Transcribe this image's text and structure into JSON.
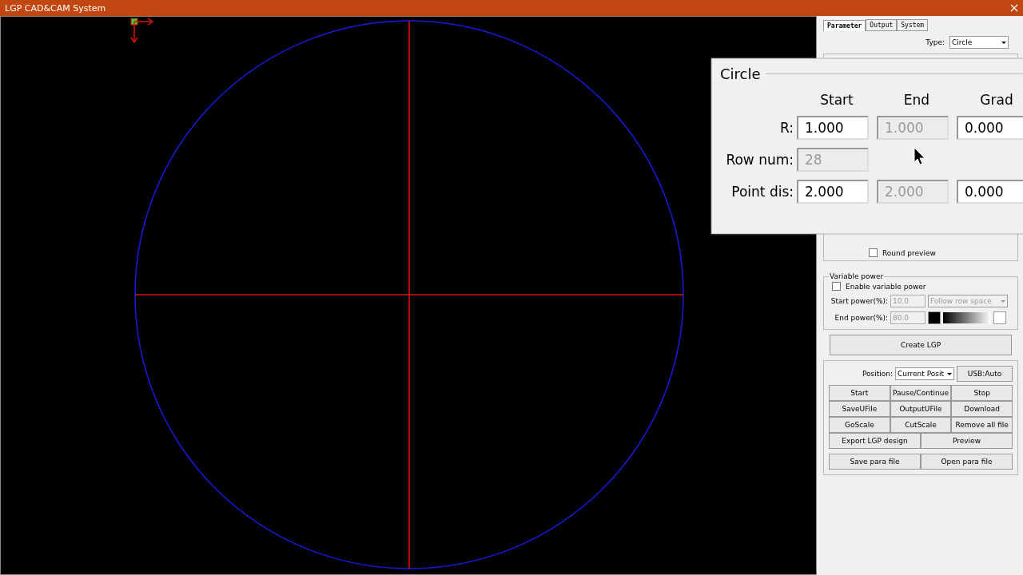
{
  "window": {
    "title": "LGP CAD&CAM System"
  },
  "tabs": [
    {
      "label": "Parameter",
      "selected": true
    },
    {
      "label": "Output",
      "selected": false
    },
    {
      "label": "System",
      "selected": false
    }
  ],
  "type": {
    "label": "Type:",
    "value": "Circle"
  },
  "round_preview": {
    "label": "Round preview",
    "checked": false
  },
  "variable_power": {
    "title": "Variable power",
    "enable": {
      "label": "Enable variable power",
      "checked": false
    },
    "start_power": {
      "label": "Start power(%):",
      "value": "10.0",
      "disabled": true
    },
    "mode": {
      "value": "Follow row space",
      "disabled": true
    },
    "end_power": {
      "label": "End power(%):",
      "value": "80.0",
      "disabled": true
    }
  },
  "create_button": "Create LGP",
  "position": {
    "label": "Position:",
    "value": "Current Posit"
  },
  "usb_button": "USB:Auto",
  "button_rows": [
    [
      "Start",
      "Pause/Continue",
      "Stop"
    ],
    [
      "SaveUFile",
      "OutputUFile",
      "Download"
    ],
    [
      "GoScale",
      "CutScale",
      "Remove all file"
    ],
    [
      "Export LGP design",
      "Preview"
    ]
  ],
  "file_buttons": [
    "Save para file",
    "Open para file"
  ],
  "overlay": {
    "title": "Circle",
    "columns": [
      "Start",
      "End",
      "Grad"
    ],
    "rows": [
      {
        "label": "R:",
        "fields": [
          {
            "value": "1.000",
            "disabled": false
          },
          {
            "value": "1.000",
            "disabled": true
          },
          {
            "value": "0.000",
            "disabled": false
          }
        ]
      },
      {
        "label": "Row num:",
        "fields": [
          {
            "value": "28",
            "disabled": true
          }
        ]
      },
      {
        "label": "Point dis:",
        "fields": [
          {
            "value": "2.000",
            "disabled": false
          },
          {
            "value": "2.000",
            "disabled": true
          },
          {
            "value": "0.000",
            "disabled": false
          }
        ]
      }
    ]
  }
}
